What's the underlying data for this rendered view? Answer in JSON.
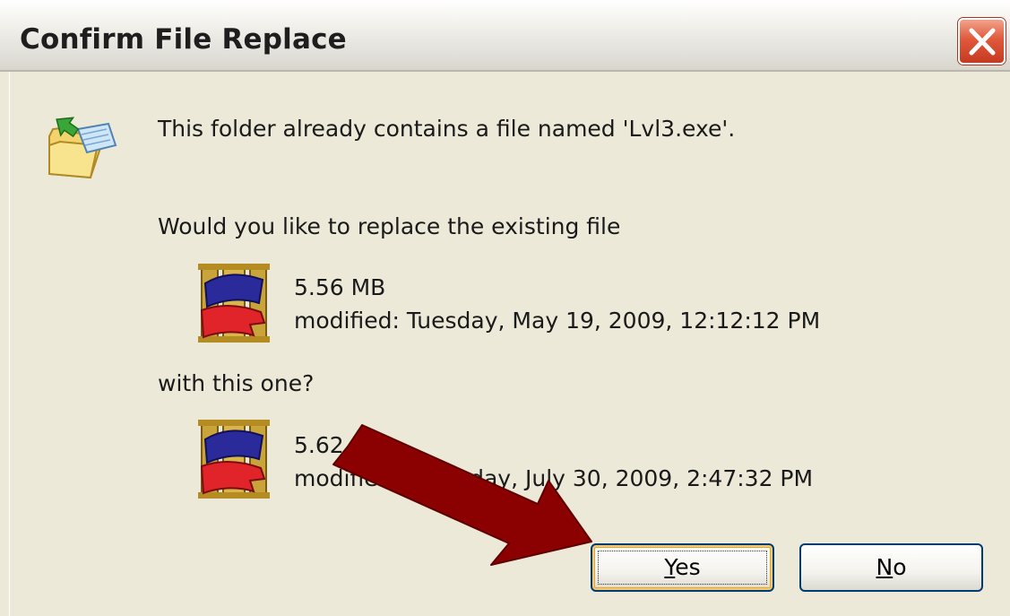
{
  "window": {
    "title": "Confirm File Replace",
    "close_icon": "close-x-icon"
  },
  "dialog": {
    "icon": "folder-replace-icon",
    "message": "This folder already contains a file named 'Lvl3.exe'.",
    "question": "Would you like to replace the existing file",
    "existing_file": {
      "icon": "heroes-iii-app-icon",
      "size": "5.56 MB",
      "modified": "modified: Tuesday, May 19, 2009, 12:12:12 PM"
    },
    "with_label": "with this one?",
    "new_file": {
      "icon": "heroes-iii-app-icon",
      "size": "5.62 MB",
      "modified": "modified: Thursday, July 30, 2009, 2:47:32 PM"
    }
  },
  "buttons": {
    "yes_mnemonic": "Y",
    "yes_rest": "es",
    "no_mnemonic": "N",
    "no_rest": "o"
  },
  "annotation": {
    "arrow_icon": "red-arrow-annotation",
    "arrow_color": "#8b0000"
  },
  "colors": {
    "dialog_bg": "#ece9d8",
    "close_red": "#e0593b",
    "button_border": "#003c74",
    "focus_orange": "#e5a531"
  }
}
